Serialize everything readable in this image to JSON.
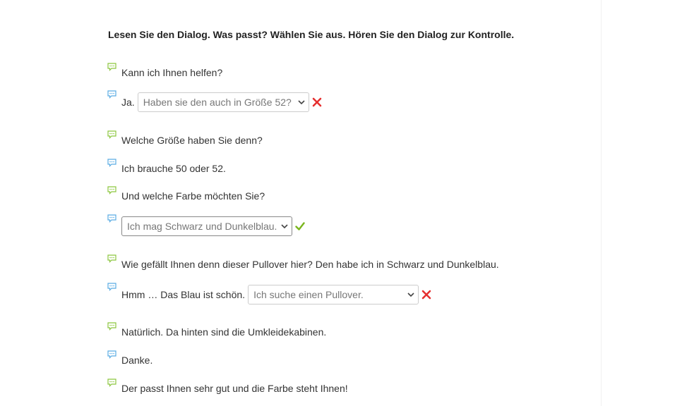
{
  "instruction": "Lesen Sie den Dialog. Was passt? Wählen Sie aus. Hören Sie den Dialog zur Kontrolle.",
  "colors": {
    "speaker_a": "#8cc63f",
    "speaker_b": "#5aace3",
    "correct": "#7ab51d",
    "incorrect": "#e53030"
  },
  "dialog": [
    {
      "speaker": "speaker_a",
      "icon": "speech-bubble-icon",
      "text": "Kann ich Ihnen helfen?"
    },
    {
      "speaker": "speaker_b",
      "icon": "speech-bubble-icon",
      "prefix": "Ja.",
      "select": {
        "value": "Haben sie den auch in Größe 52?",
        "result": "incorrect",
        "result_icon": "cross-icon"
      }
    },
    {
      "speaker": "speaker_a",
      "icon": "speech-bubble-icon",
      "text": "Welche Größe haben Sie denn?"
    },
    {
      "speaker": "speaker_b",
      "icon": "speech-bubble-icon",
      "text": "Ich brauche 50 oder 52."
    },
    {
      "speaker": "speaker_a",
      "icon": "speech-bubble-icon",
      "text": "Und welche Farbe möchten Sie?"
    },
    {
      "speaker": "speaker_b",
      "icon": "speech-bubble-icon",
      "select": {
        "value": "Ich mag Schwarz und Dunkelblau.",
        "result": "correct",
        "result_icon": "check-icon"
      }
    },
    {
      "speaker": "speaker_a",
      "icon": "speech-bubble-icon",
      "text": "Wie gefällt Ihnen denn dieser Pullover hier? Den habe ich in Schwarz und Dunkelblau."
    },
    {
      "speaker": "speaker_b",
      "icon": "speech-bubble-icon",
      "prefix": "Hmm … Das Blau ist schön.",
      "select": {
        "value": "Ich suche einen Pullover.",
        "result": "incorrect",
        "result_icon": "cross-icon"
      }
    },
    {
      "speaker": "speaker_a",
      "icon": "speech-bubble-icon",
      "text": "Natürlich. Da hinten sind die Umkleidekabinen."
    },
    {
      "speaker": "speaker_b",
      "icon": "speech-bubble-icon",
      "text": "Danke."
    },
    {
      "speaker": "speaker_a",
      "icon": "speech-bubble-icon",
      "text": "Der passt Ihnen sehr gut und die Farbe steht Ihnen!"
    }
  ]
}
